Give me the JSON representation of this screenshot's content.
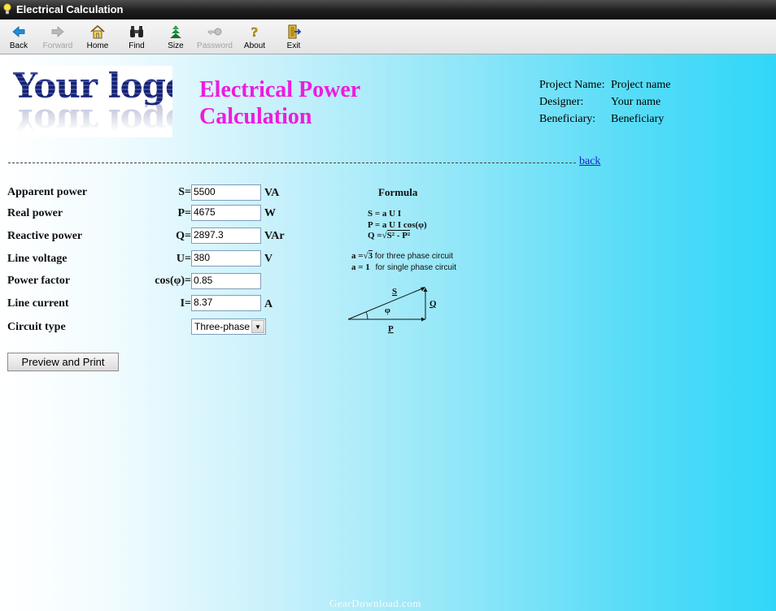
{
  "window": {
    "title": "Electrical Calculation"
  },
  "toolbar": {
    "buttons": [
      {
        "label": "Back",
        "icon": "back-arrow-icon",
        "enabled": true
      },
      {
        "label": "Forward",
        "icon": "forward-arrow-icon",
        "enabled": false
      },
      {
        "label": "Home",
        "icon": "home-icon",
        "enabled": true
      },
      {
        "label": "Find",
        "icon": "binoculars-icon",
        "enabled": true
      },
      {
        "label": "Size",
        "icon": "size-icon",
        "enabled": true
      },
      {
        "label": "Password",
        "icon": "key-icon",
        "enabled": false
      },
      {
        "label": "About",
        "icon": "question-icon",
        "enabled": true
      },
      {
        "label": "Exit",
        "icon": "exit-door-icon",
        "enabled": true
      }
    ]
  },
  "logo": {
    "text": "Your logo"
  },
  "heading": {
    "line1": "Electrical Power",
    "line2": "Calculation",
    "color": "#ee1bde"
  },
  "project": {
    "name_label": "Project Name:",
    "name_value": "Project name",
    "designer_label": "Designer:",
    "designer_value": "Your name",
    "beneficiary_label": "Beneficiary:",
    "beneficiary_value": "Beneficiary"
  },
  "nav": {
    "back_link": "back"
  },
  "form": {
    "apparent": {
      "label": "Apparent power",
      "symbol": "S=",
      "value": "5500",
      "unit": "VA"
    },
    "real": {
      "label": "Real power",
      "symbol": "P=",
      "value": "4675",
      "unit": "W"
    },
    "reactive": {
      "label": "Reactive power",
      "symbol": "Q=",
      "value": "2897.3",
      "unit": "VAr"
    },
    "voltage": {
      "label": "Line voltage",
      "symbol": "U=",
      "value": "380",
      "unit": "V"
    },
    "pf": {
      "label": "Power factor",
      "symbol": "cos(φ)=",
      "value": "0.85"
    },
    "current": {
      "label": "Line current",
      "symbol": "I=",
      "value": "8.37",
      "unit": "A"
    },
    "circuit": {
      "label": "Circuit type",
      "value": "Three-phase"
    }
  },
  "actions": {
    "print_label": "Preview and Print"
  },
  "formula": {
    "title": "Formula",
    "s": "S = a U I",
    "p": "P = a U I cos(φ)",
    "q_prefix": "Q =",
    "q_radicand": "S² - P²",
    "a3_prefix": "a =",
    "a3_root": "3",
    "a3_text": "for three phase circuit",
    "a1_prefix": "a = 1",
    "a1_text": "for single phase circuit",
    "tri_s": "S",
    "tri_q": "Q",
    "tri_p": "P",
    "tri_phi": "φ"
  },
  "watermark": "GearDownload.com"
}
